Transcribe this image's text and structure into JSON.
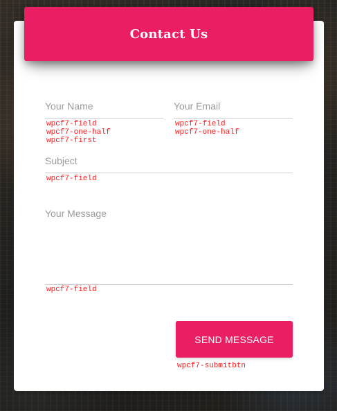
{
  "form": {
    "title": "Contact Us",
    "fields": {
      "name": {
        "placeholder": "Your Name",
        "value": "",
        "classes": "wpcf7-field\nwpcf7-one-half\nwpcf7-first"
      },
      "email": {
        "placeholder": "Your Email",
        "value": "",
        "classes": "wpcf7-field\nwpcf7-one-half"
      },
      "subject": {
        "placeholder": "Subject",
        "value": "",
        "classes": "wpcf7-field"
      },
      "message": {
        "placeholder": "Your Message",
        "value": "",
        "classes": "wpcf7-field"
      }
    },
    "submit": {
      "label": "SEND MESSAGE",
      "classes": "wpcf7-submitbtn"
    }
  },
  "colors": {
    "accent": "#e91e63",
    "debug_text": "#ff1a1a",
    "placeholder": "#9a9a9a",
    "underline": "#cfcfcf"
  }
}
